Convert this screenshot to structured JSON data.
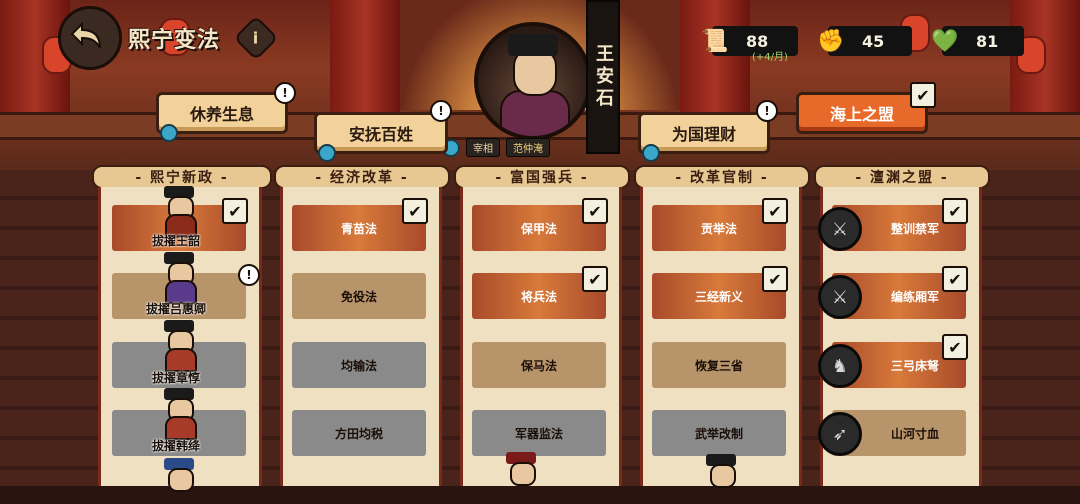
{
  "header": {
    "title": "熙宁变法",
    "info_label": "i"
  },
  "minister": {
    "name": "王安石",
    "assistant_role": "宰相",
    "assistant_name": "范仲淹"
  },
  "resources": [
    {
      "icon": "scroll-icon",
      "value": "88",
      "sub": "(+4/月)"
    },
    {
      "icon": "fist-icon",
      "value": "45"
    },
    {
      "icon": "heart-coin-icon",
      "value": "81"
    }
  ],
  "policies": [
    {
      "label": "休养生息",
      "alert": "!"
    },
    {
      "label": "安抚百姓",
      "alert": "!"
    },
    {
      "label": "为国理财",
      "alert": "!"
    },
    {
      "label": "海上之盟",
      "done": "✔"
    }
  ],
  "columns": [
    {
      "title": "- 熙宁新政 -"
    },
    {
      "title": "- 经济改革 -"
    },
    {
      "title": "- 富国强兵 -"
    },
    {
      "title": "- 改革官制 -"
    },
    {
      "title": "- 澶渊之盟 -"
    }
  ],
  "col1": [
    {
      "label": "拔擢王韶",
      "state": "done"
    },
    {
      "label": "拔擢吕惠卿",
      "state": "ready",
      "alert": "!"
    },
    {
      "label": "拔擢章惇",
      "state": "locked"
    },
    {
      "label": "拔擢韩绛",
      "state": "locked"
    }
  ],
  "col2": [
    {
      "label": "青苗法",
      "state": "done"
    },
    {
      "label": "免役法",
      "state": "ready"
    },
    {
      "label": "均输法",
      "state": "locked"
    },
    {
      "label": "方田均税",
      "state": "locked"
    }
  ],
  "col3": [
    {
      "label": "保甲法",
      "state": "done"
    },
    {
      "label": "将兵法",
      "state": "done"
    },
    {
      "label": "保马法",
      "state": "ready"
    },
    {
      "label": "军器监法",
      "state": "locked"
    }
  ],
  "col4": [
    {
      "label": "贡举法",
      "state": "done"
    },
    {
      "label": "三经新义",
      "state": "done"
    },
    {
      "label": "恢复三省",
      "state": "ready"
    },
    {
      "label": "武举改制",
      "state": "locked"
    }
  ],
  "col5": [
    {
      "label": "整训禁军",
      "state": "done",
      "icon": "soldier-icon"
    },
    {
      "label": "编练厢军",
      "state": "done",
      "icon": "spear-icon"
    },
    {
      "label": "三弓床弩",
      "state": "done",
      "icon": "crossbow-icon"
    },
    {
      "label": "山河寸血",
      "state": "ready",
      "icon": "archer-icon"
    }
  ],
  "colors": {
    "done": "#d87a3a",
    "ready": "#b8946a",
    "locked": "#8a8a8a",
    "accent": "#e86a2a"
  }
}
